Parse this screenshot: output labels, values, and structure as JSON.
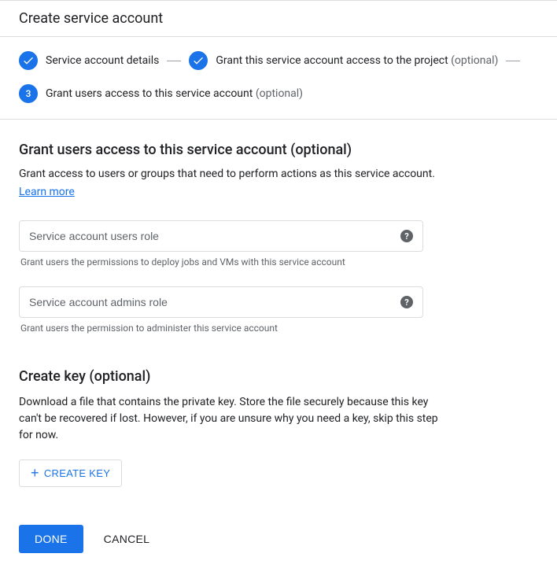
{
  "header": {
    "title": "Create service account"
  },
  "stepper": {
    "step1": {
      "label": "Service account details"
    },
    "step2": {
      "label": "Grant this service account access to the project",
      "optional": "(optional)"
    },
    "step3": {
      "number": "3",
      "label": "Grant users access to this service account",
      "optional": "(optional)"
    }
  },
  "grantUsersSection": {
    "title": "Grant users access to this service account (optional)",
    "description": "Grant access to users or groups that need to perform actions as this service account.",
    "learnMore": "Learn more"
  },
  "fields": {
    "usersRole": {
      "placeholder": "Service account users role",
      "hint": "Grant users the permissions to deploy jobs and VMs with this service account"
    },
    "adminsRole": {
      "placeholder": "Service account admins role",
      "hint": "Grant users the permission to administer this service account"
    }
  },
  "createKeySection": {
    "title": "Create key (optional)",
    "description": "Download a file that contains the private key. Store the file securely because this key can't be recovered if lost. However, if you are unsure why you need a key, skip this step for now.",
    "button": "CREATE KEY"
  },
  "actions": {
    "done": "DONE",
    "cancel": "CANCEL"
  },
  "helpGlyph": "?"
}
